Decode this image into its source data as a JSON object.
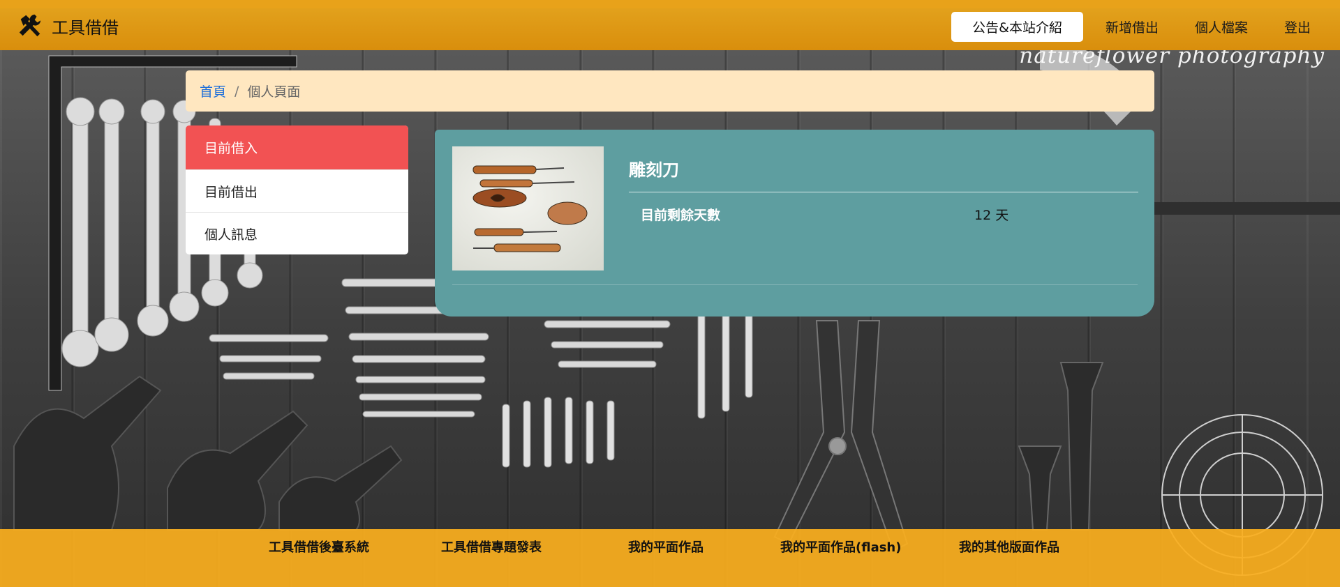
{
  "app": {
    "brand_title": "工具借借",
    "brand_icon": "tools-icon"
  },
  "navbar": {
    "items": [
      {
        "label": "公告&本站介紹",
        "active": true
      },
      {
        "label": "新增借出",
        "active": false
      },
      {
        "label": "個人檔案",
        "active": false
      },
      {
        "label": "登出",
        "active": false
      }
    ]
  },
  "background": {
    "watermark": "natureflower photography"
  },
  "breadcrumb": {
    "home": "首頁",
    "separator": "/",
    "current": "個人頁面"
  },
  "side_menu": {
    "items": [
      {
        "label": "目前借入",
        "active": true
      },
      {
        "label": "目前借出",
        "active": false
      },
      {
        "label": "個人訊息",
        "active": false
      }
    ]
  },
  "card": {
    "title": "雕刻刀",
    "remaining_label": "目前剩餘天數",
    "remaining_value": "12 天",
    "image_icon": "carving-knives-photo"
  },
  "footer": {
    "links": [
      "工具借借後臺系統",
      "工具借借專題發表",
      "我的平面作品",
      "我的平面作品(flash)",
      "我的其他版面作品"
    ]
  },
  "colors": {
    "navbar": "#d98e0c",
    "nav_active_bg": "#ffffff",
    "breadcrumb_bg": "#ffe7c0",
    "link_blue": "#1e6fd9",
    "side_active": "#f25253",
    "card_bg": "#5e9ea0",
    "footer": "#faae1e"
  }
}
